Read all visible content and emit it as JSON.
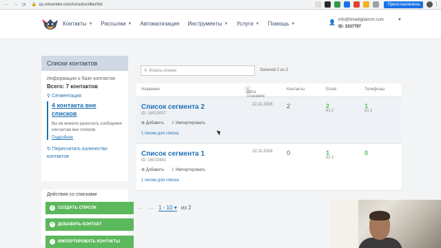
{
  "browser": {
    "url": "cp.unisender.com/ru/subscriber/list",
    "paused_label": "Приостановлена"
  },
  "header": {
    "menu": [
      {
        "label": "Контакты",
        "caret": true
      },
      {
        "label": "Рассылки",
        "caret": true
      },
      {
        "label": "Автоматизация",
        "caret": false
      },
      {
        "label": "Инструменты",
        "caret": true
      },
      {
        "label": "Услуги",
        "caret": true
      },
      {
        "label": "Помощь",
        "caret": true
      }
    ],
    "user_email": "info@timedigitalcrm.com",
    "user_id": "ID: 3337797"
  },
  "sidebar": {
    "title": "Списки контактов",
    "info": "Информация о базе контактов",
    "total": "Всего: 7 контактов",
    "segmentation": "Сегментация",
    "callout_big": "4 контакта вне списков",
    "callout_small": "Вы не можете разослать сообщения контактам вне списков.",
    "callout_more": "Подробнее",
    "recount": "Пересчитать количество контактов",
    "actions_title": "Действия со списками",
    "buttons": {
      "create": "Создать список",
      "add": "Добавить контакт",
      "import": "Импортировать контакты"
    }
  },
  "main": {
    "search_placeholder": "Искать списки",
    "records": "Записей 2 из 2",
    "columns": {
      "name": "Название",
      "date": "Дата создания",
      "contacts": "Контакты",
      "email": "Email",
      "phones": "Телефоны"
    },
    "rows": [
      {
        "name": "Список сегмента 2",
        "id": "ID: 16013057",
        "add": "Добавить",
        "import": "Импортировать",
        "letters": "1 писем для списка",
        "date": "22.11.2018",
        "contacts": "2",
        "email": "2",
        "email_sub": "из 2",
        "phones": "1",
        "phones_sub": "из 1"
      },
      {
        "name": "Список сегмента 1",
        "id": "ID: 16010481",
        "add": "Добавить",
        "import": "Импортировать",
        "letters": "1 писем для списка",
        "date": "22.11.2018",
        "contacts": "0",
        "email": "1",
        "email_sub": "из 1",
        "phones": "0",
        "phones_sub": ""
      }
    ],
    "pager": {
      "range": "1 - 10",
      "of": "из 2"
    }
  },
  "colors": {
    "accent_blue": "#1f6fb5",
    "green": "#5cb85c"
  }
}
